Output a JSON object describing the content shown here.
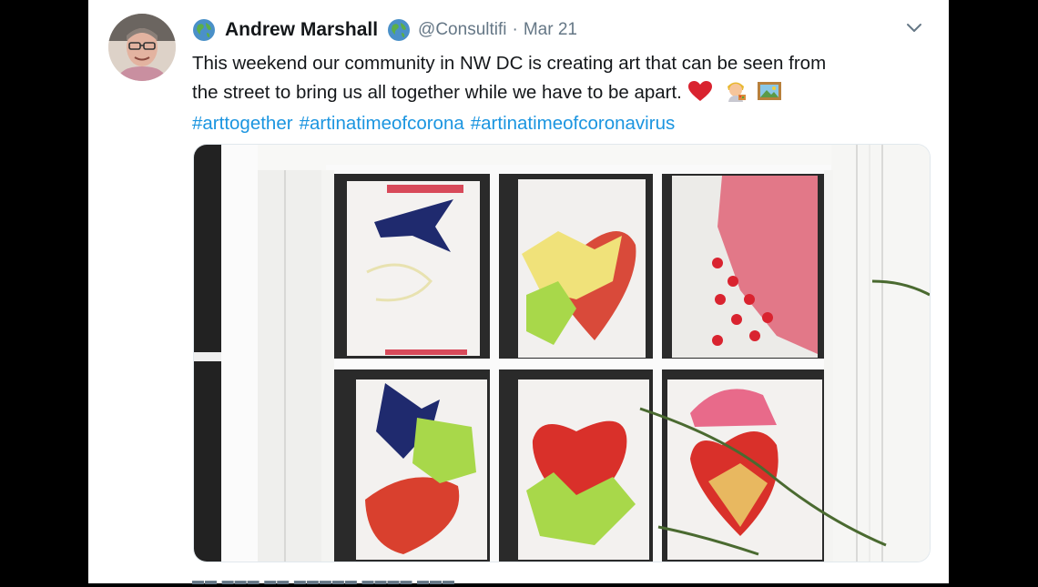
{
  "tweet": {
    "author_name": "Andrew Marshall",
    "handle": "@Consultifi",
    "separator": "·",
    "date": "Mar 21",
    "text_line1": "This weekend our community in NW DC is creating art that can be seen from",
    "text_line2": "the street to bring us all together while we have to be apart.",
    "hashtags": [
      "#arttogether",
      "#artinatimeofcorona",
      "#artinatimeofcoronavirus"
    ]
  },
  "icons": {
    "globe": "globe-icon",
    "heart": "red-heart-emoji",
    "artist": "artist-emoji",
    "picture": "framed-picture-emoji",
    "menu": "chevron-down-icon"
  },
  "colors": {
    "text": "#14171a",
    "muted": "#657786",
    "link": "#1b95e0",
    "heart_red": "#d9232f"
  }
}
